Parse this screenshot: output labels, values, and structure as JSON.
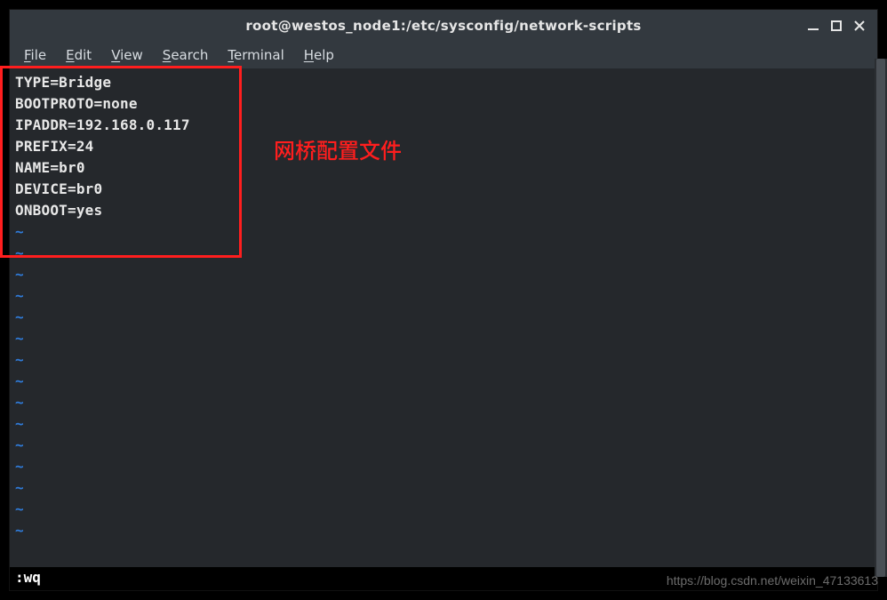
{
  "window": {
    "title": "root@westos_node1:/etc/sysconfig/network-scripts"
  },
  "menubar": {
    "items": [
      {
        "key": "F",
        "rest": "ile"
      },
      {
        "key": "E",
        "rest": "dit"
      },
      {
        "key": "V",
        "rest": "iew"
      },
      {
        "key": "S",
        "rest": "earch"
      },
      {
        "key": "T",
        "rest": "erminal"
      },
      {
        "key": "H",
        "rest": "elp"
      }
    ]
  },
  "editor": {
    "content_lines": [
      "TYPE=Bridge",
      "BOOTPROTO=none",
      "IPADDR=192.168.0.117",
      "PREFIX=24",
      "NAME=br0",
      "DEVICE=br0",
      "ONBOOT=yes"
    ],
    "tilde_rows": 15
  },
  "annotation": "网桥配置文件",
  "statusline": ":wq",
  "watermark": "https://blog.csdn.net/weixin_47133613"
}
